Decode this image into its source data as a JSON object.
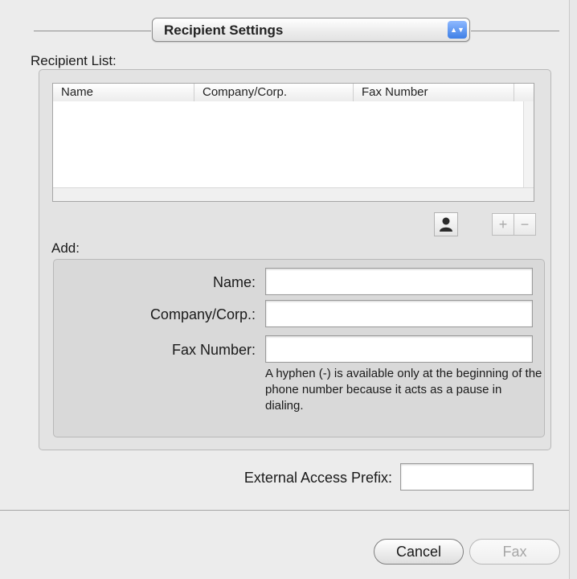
{
  "header": {
    "popup_value": "Recipient Settings",
    "popup_arrows": "▲▼"
  },
  "recipient_list": {
    "label": "Recipient List:",
    "columns": [
      "Name",
      "Company/Corp.",
      "Fax Number"
    ],
    "rows": []
  },
  "toolbar": {
    "add_symbol": "+",
    "remove_symbol": "−",
    "address_book_icon": "person-icon"
  },
  "add": {
    "label": "Add:",
    "name_label": "Name:",
    "name_value": "",
    "company_label": "Company/Corp.:",
    "company_value": "",
    "fax_label": "Fax Number:",
    "fax_value": "",
    "hint": "A hyphen (-) is available only at the beginning of the phone number because it acts as a pause in dialing."
  },
  "prefix": {
    "label": "External Access Prefix:",
    "value": ""
  },
  "buttons": {
    "cancel": "Cancel",
    "fax": "Fax"
  },
  "colors": {
    "popup_accent": "#3e7fe6",
    "dialog_bg": "#ececec"
  }
}
